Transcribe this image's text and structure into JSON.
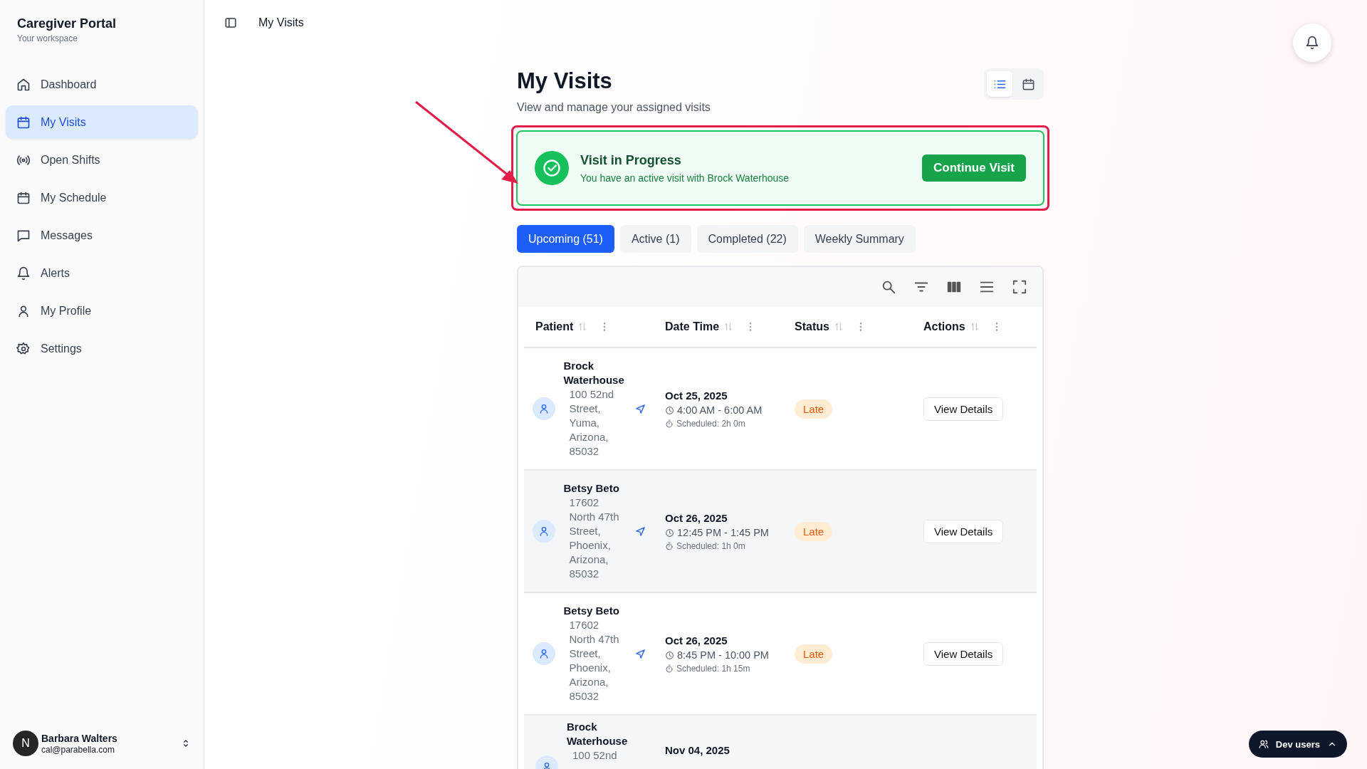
{
  "sidebar": {
    "title": "Caregiver Portal",
    "subtitle": "Your workspace",
    "items": [
      {
        "label": "Dashboard",
        "selected": false
      },
      {
        "label": "My Visits",
        "selected": true
      },
      {
        "label": "Open Shifts",
        "selected": false
      },
      {
        "label": "My Schedule",
        "selected": false
      },
      {
        "label": "Messages",
        "selected": false
      },
      {
        "label": "Alerts",
        "selected": false
      },
      {
        "label": "My Profile",
        "selected": false
      },
      {
        "label": "Settings",
        "selected": false
      }
    ],
    "user": {
      "initial": "N",
      "name": "Barbara Walters",
      "email": "cal@parabella.com"
    }
  },
  "header": {
    "breadcrumb": "My Visits"
  },
  "page": {
    "title": "My Visits",
    "subtitle": "View and manage your assigned visits",
    "view_toggle": [
      {
        "kind": "list",
        "selected": true
      },
      {
        "kind": "calendar",
        "selected": false
      }
    ]
  },
  "banner": {
    "title": "Visit in Progress",
    "message": "You have an active visit with Brock Waterhouse",
    "button": "Continue Visit"
  },
  "tabs": [
    {
      "label": "Upcoming (51)",
      "selected": true
    },
    {
      "label": "Active (1)",
      "selected": false
    },
    {
      "label": "Completed (22)",
      "selected": false
    },
    {
      "label": "Weekly Summary",
      "selected": false
    }
  ],
  "table": {
    "columns": [
      "Patient",
      "Date Time",
      "Status",
      "Actions"
    ],
    "rows": [
      {
        "name": "Brock Waterhouse",
        "address": "100 52nd Street, Yuma, Arizona, 85032",
        "date": "Oct 25, 2025",
        "time": "4:00 AM - 6:00 AM",
        "scheduled": "Scheduled: 2h 0m",
        "status": "Late",
        "action": "View Details"
      },
      {
        "name": "Betsy Beto",
        "address": "17602 North 47th Street, Phoenix, Arizona, 85032",
        "date": "Oct 26, 2025",
        "time": "12:45 PM - 1:45 PM",
        "scheduled": "Scheduled: 1h 0m",
        "status": "Late",
        "action": "View Details"
      },
      {
        "name": "Betsy Beto",
        "address": "17602 North 47th Street, Phoenix, Arizona, 85032",
        "date": "Oct 26, 2025",
        "time": "8:45 PM - 10:00 PM",
        "scheduled": "Scheduled: 1h 15m",
        "status": "Late",
        "action": "View Details"
      },
      {
        "name": "Brock Waterhouse",
        "address": "100 52nd",
        "date": "Nov 04, 2025"
      }
    ]
  },
  "dev_button": "Dev users"
}
